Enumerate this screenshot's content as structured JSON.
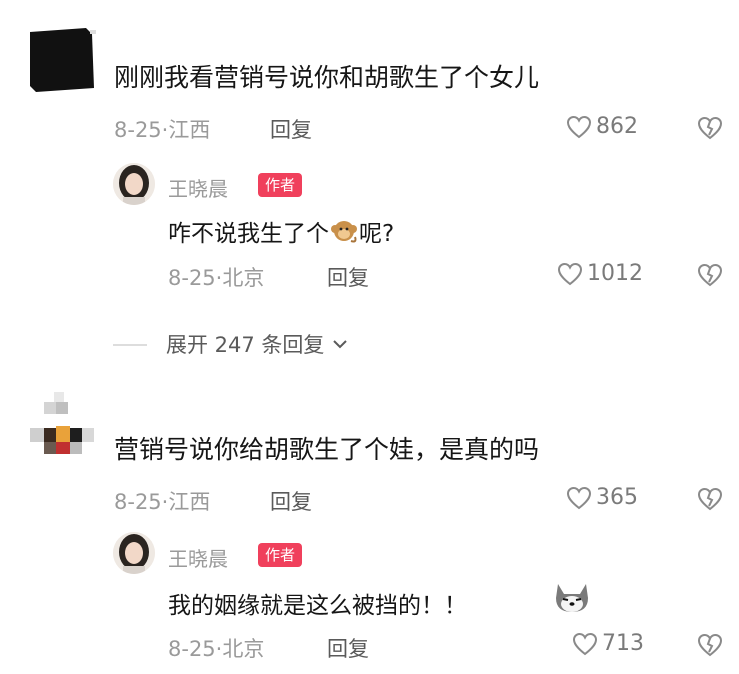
{
  "comments": [
    {
      "text": "刚刚我看营销号说你和胡歌生了个女儿",
      "date": "8-25·江西",
      "reply_label": "回复",
      "likes": "862",
      "reply": {
        "author": "王晓晨",
        "badge": "作者",
        "text_before": "咋不说我生了个",
        "text_after": "呢?",
        "date": "8-25·北京",
        "reply_label": "回复",
        "likes": "1012"
      },
      "expand_label": "展开 247 条回复"
    },
    {
      "text": "营销号说你给胡歌生了个娃，是真的吗",
      "date": "8-25·江西",
      "reply_label": "回复",
      "likes": "365",
      "reply": {
        "author": "王晓晨",
        "badge": "作者",
        "text": "我的姻缘就是这么被挡的！！",
        "date": "8-25·北京",
        "reply_label": "回复",
        "likes": "713"
      }
    }
  ],
  "icons": {
    "like": "heart-outline-icon",
    "dislike": "broken-heart-icon",
    "expand": "chevron-down-icon",
    "emoji_monkey": "monkey-emoji",
    "emoji_dog": "dog-emoji"
  },
  "colors": {
    "badge": "#f0405c",
    "meta": "#9a9a9a"
  }
}
